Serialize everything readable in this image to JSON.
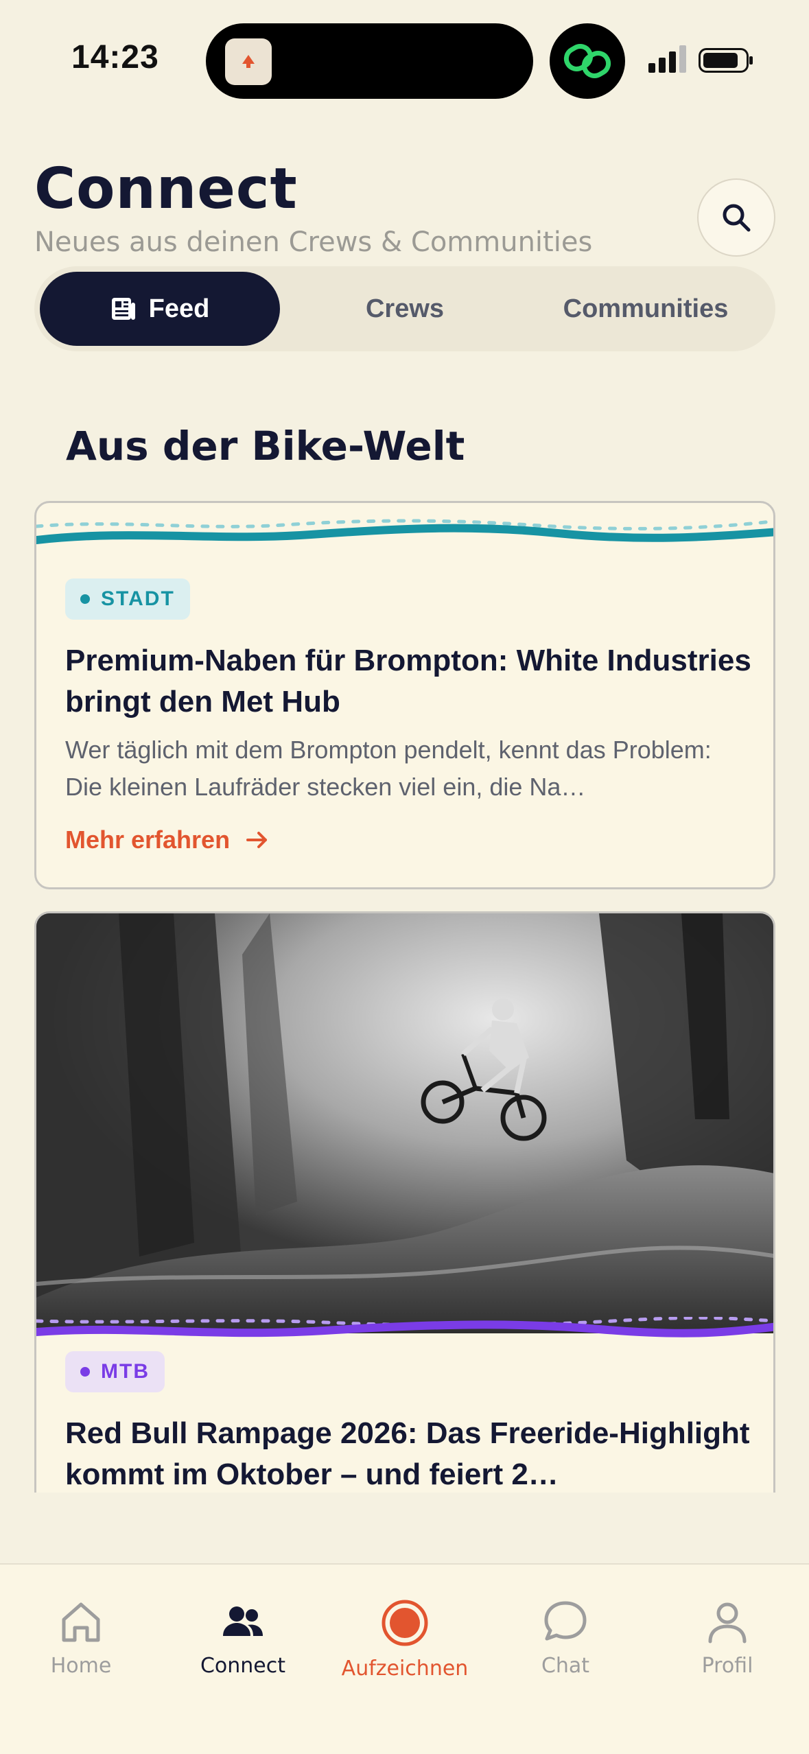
{
  "status": {
    "time": "14:23"
  },
  "header": {
    "title": "Connect",
    "subtitle": "Neues aus deinen Crews & Communities"
  },
  "tabs": [
    {
      "label": "Feed",
      "active": true
    },
    {
      "label": "Crews",
      "active": false
    },
    {
      "label": "Communities",
      "active": false
    }
  ],
  "section": {
    "title": "Aus der Bike-Welt"
  },
  "articles": [
    {
      "category": "STADT",
      "category_color": "#1793a3",
      "title": "Premium-Naben für Brompton: White Industries bringt den Met Hub",
      "excerpt": "Wer täglich mit dem Brompton pendelt, kennt das Problem: Die kleinen Laufräder stecken viel ein, die Na…",
      "cta": "Mehr erfahren"
    },
    {
      "category": "MTB",
      "category_color": "#7a3ce6",
      "title": "Red Bull Rampage 2026: Das Freeride-Highlight kommt im Oktober – und feiert 2…"
    }
  ],
  "nav": [
    {
      "label": "Home",
      "icon": "home-icon"
    },
    {
      "label": "Connect",
      "icon": "people-icon",
      "active": true
    },
    {
      "label": "Aufzeichnen",
      "icon": "record-icon"
    },
    {
      "label": "Chat",
      "icon": "chat-icon"
    },
    {
      "label": "Profil",
      "icon": "profile-icon"
    }
  ],
  "colors": {
    "accent": "#e2552f",
    "navy": "#141833",
    "background": "#f5f1e1"
  }
}
